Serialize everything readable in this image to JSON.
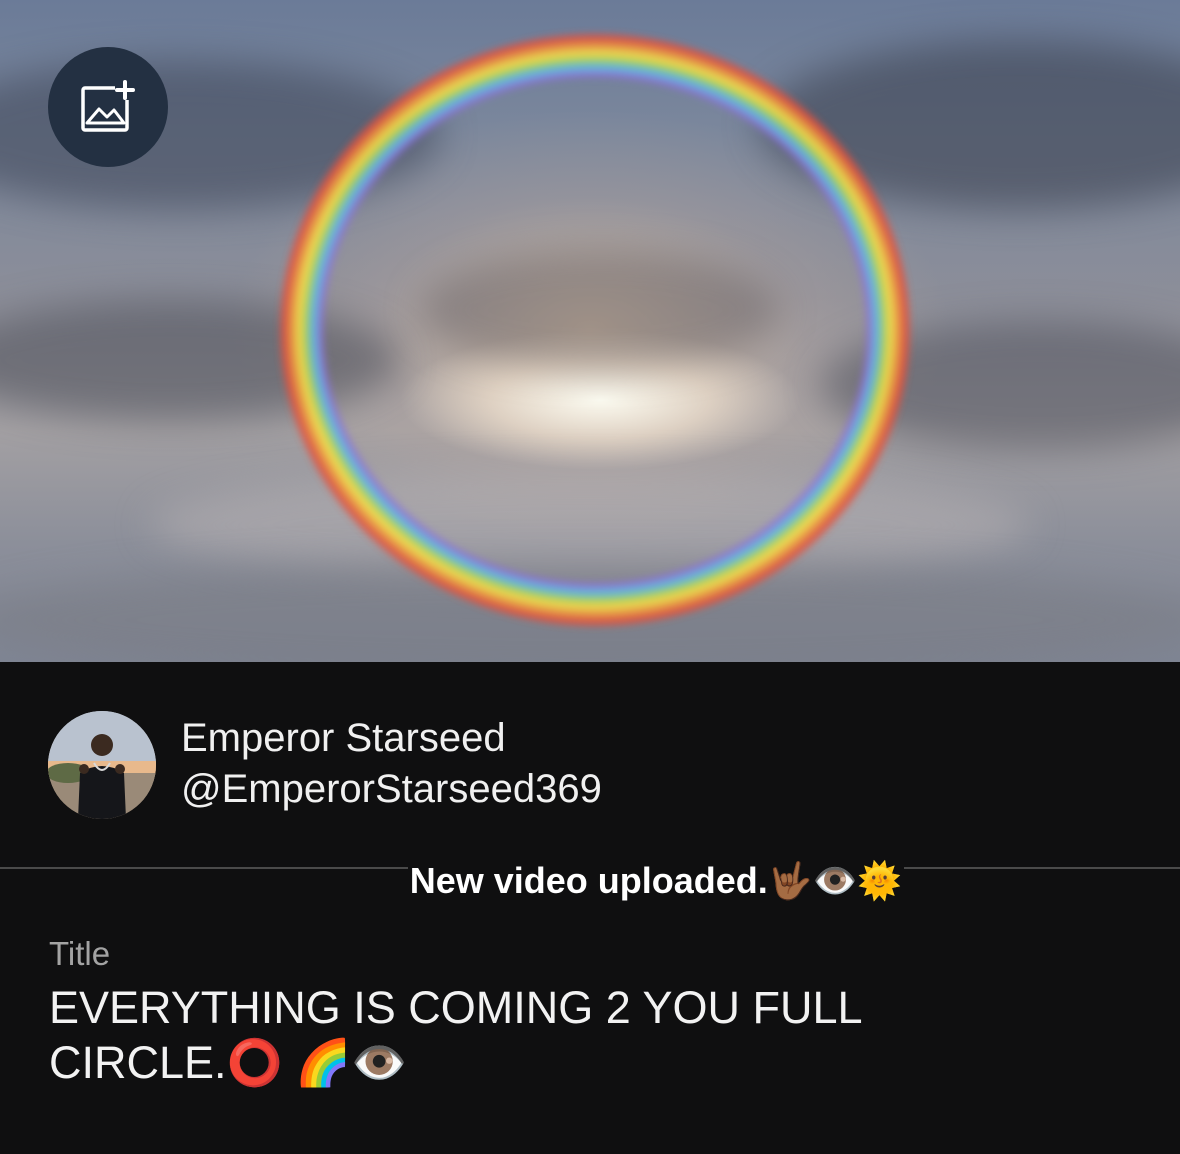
{
  "post": {
    "author_name": "Emperor Starseed",
    "author_handle": "@EmperorStarseed369",
    "caption": "New video uploaded.🤟🏾👁️🌞",
    "title_label": "Title",
    "title": "EVERYTHING IS COMING 2 YOU FULL CIRCLE.⭕ 🌈👁️"
  },
  "hero": {
    "image": "rainbow-halo-sky",
    "add_image_icon": "image-add-icon"
  },
  "colors": {
    "background": "#0f0f10",
    "text_primary": "#f2f2f2",
    "text_secondary": "#a3a3a3",
    "button_bg": "#233042",
    "divider": "#4a4a4a"
  }
}
